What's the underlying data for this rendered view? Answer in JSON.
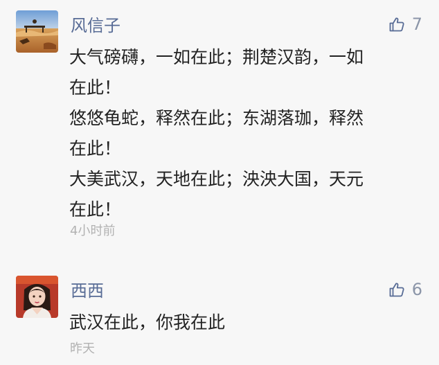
{
  "comments": [
    {
      "nickname": "风信子",
      "likes": "7",
      "lines": [
        "大气磅礴，一如在此；荆楚汉韵，一如",
        "在此！",
        "悠悠龟蛇，释然在此；东湖落珈，释然",
        "在此！",
        "大美武汉，天地在此；泱泱大国，天元",
        "在此！"
      ],
      "time": "4小时前",
      "like_icon": "thumbs-up-icon"
    },
    {
      "nickname": "西西",
      "likes": "6",
      "lines": [
        "武汉在此，你我在此"
      ],
      "time": "昨天",
      "like_icon": "thumbs-up-icon"
    }
  ],
  "colors": {
    "background": "#f7f7f7",
    "nickname": "#576b95",
    "text": "#222222",
    "meta": "#b2b2b2",
    "like": "#8b95a8"
  }
}
